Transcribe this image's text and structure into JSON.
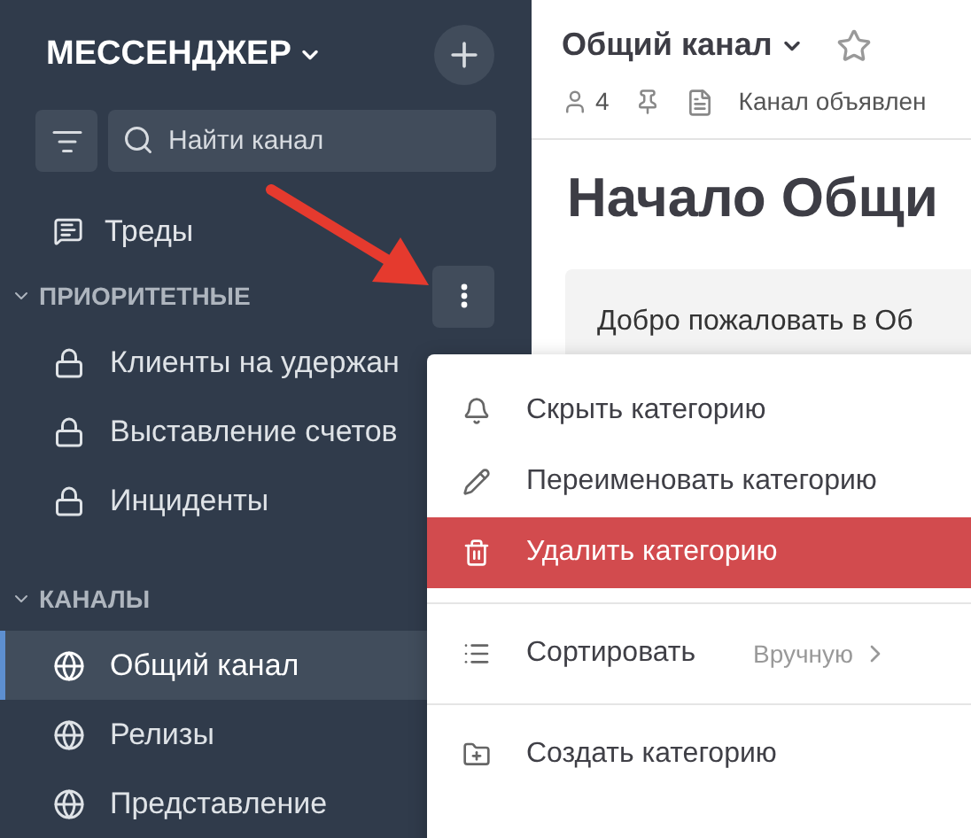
{
  "sidebar": {
    "workspace": "МЕССЕНДЖЕР",
    "search": {
      "placeholder": "Найти канал"
    },
    "threads": "Треды",
    "categories": [
      {
        "title": "ПРИОРИТЕТНЫЕ",
        "expanded": true,
        "menu_open": true,
        "items": [
          {
            "label": "Клиенты на удержан",
            "kind": "private",
            "selected": false
          },
          {
            "label": "Выставление счетов",
            "kind": "private",
            "selected": false
          },
          {
            "label": "Инциденты",
            "kind": "private",
            "selected": false
          }
        ]
      },
      {
        "title": "КАНАЛЫ",
        "expanded": true,
        "menu_open": false,
        "items": [
          {
            "label": "Общий канал",
            "kind": "public",
            "selected": true
          },
          {
            "label": "Релизы",
            "kind": "public",
            "selected": false
          },
          {
            "label": "Представление",
            "kind": "public",
            "selected": false
          }
        ]
      }
    ]
  },
  "channel": {
    "title": "Общий канал",
    "starred": false,
    "members": "4",
    "description": "Канал объявлен",
    "heading": "Начало Общи",
    "welcome": "Добро пожаловать в Об"
  },
  "menu": [
    {
      "kind": "item",
      "label": "Скрыть категорию",
      "selected": false
    },
    {
      "kind": "item",
      "label": "Переименовать категорию",
      "selected": false
    },
    {
      "kind": "item",
      "label": "Удалить категорию",
      "selected": true
    },
    {
      "kind": "divider"
    },
    {
      "kind": "submenu",
      "label": "Сортировать",
      "value": "Вручную",
      "selected": false
    },
    {
      "kind": "divider"
    },
    {
      "kind": "item",
      "label": "Создать категорию",
      "selected": false
    }
  ]
}
